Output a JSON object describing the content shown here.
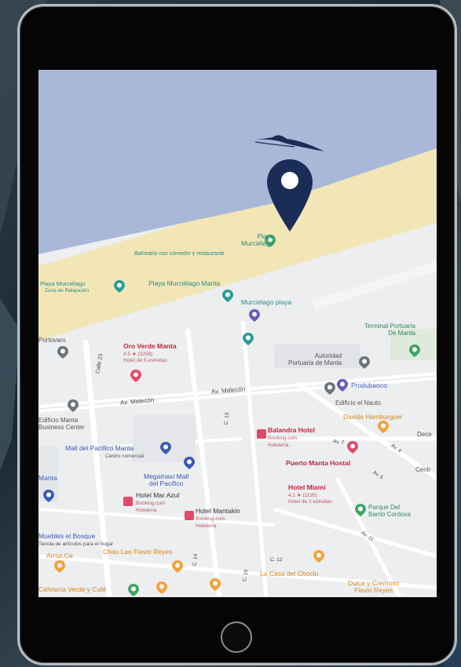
{
  "map": {
    "places": {
      "playa_murcielago_pin": "Playa\nMurciélago",
      "playa_sub": "Balneario con comedor y restaurante",
      "playa_murcielago_manta": "Playa Murciélago Manta",
      "murcielago_playa": "Murciélago playa",
      "playa_left": "Playa Murciélago",
      "playa_left_sub": "Zona de Relajación",
      "portovaro": "Portovaro",
      "oro_verde": "Oro Verde Manta",
      "oro_verde_rating": "4.5 ★ (3258)",
      "oro_verde_sub": "Hotel de 5 estrellas",
      "av_malecon_left": "Av. Malecón",
      "av_malecon_right": "Av. Malecón",
      "calle_23": "Calle 23",
      "autoridad": "Autoridad\nPortuaria de Manta",
      "terminal": "Terminal Portuaria\nDe Manta",
      "produbanco": "Produbanco",
      "edificio_nauto": "Edificio el Nauto",
      "davids": "Davids Hamburguer",
      "edificio_manta": "Edificio Manta\nBusiness Center",
      "mall": "Mall del Pacifico Manta",
      "mall_sub": "Centro comercial",
      "balandra": "Balandra Hotel",
      "balandra_sub": "Booking.com\nHotelería",
      "puerto_hostal": "Puerto Manta Hostal",
      "megamaxi": "Megamaxi Mall\ndel Pacifico",
      "mar_azul": "Hotel Mar Azul",
      "mar_azul_sub": "Booking.com\nHotelería",
      "mantakin": "Hotel Mantakin",
      "mantakin_sub": "Booking.com\nHotelería",
      "miami": "Hotel Miami",
      "miami_rating": "4.1 ★ (1135)",
      "miami_sub": "Hotel de 3 estrellas",
      "parque": "Parque Del\nBarrio Cordova",
      "manta_left": "Manta",
      "muebles": "Muebles el Bosque",
      "muebles_sub": "Tienda de artículos para el hogar",
      "arroz": "Arroz,Ca",
      "chau": "Chau Lao Flavio Reyes",
      "casa_choclo": "La Casa del Choclo",
      "dulce": "Dulce y Cremoso\nFlavio Reyes",
      "cafeteria": "Cafetería Verde y Café",
      "dece": "Dece",
      "centro": "Centr",
      "av_4": "Av. 4",
      "av_5": "Av. 5",
      "av_6": "Av. 6",
      "av_7": "Av. 7",
      "av_11": "Av. 11",
      "c12": "C. 12",
      "c13": "C. 13",
      "c14": "C. 14",
      "c19": "C. 19"
    },
    "colors": {
      "sea": "#a9b8d9",
      "sand": "#f2e6b7",
      "land": "#eceef0",
      "pin": "#1b2d57"
    },
    "icons": {
      "location_pin": "map-pin-icon",
      "logo": "stingray-logo-icon"
    }
  }
}
